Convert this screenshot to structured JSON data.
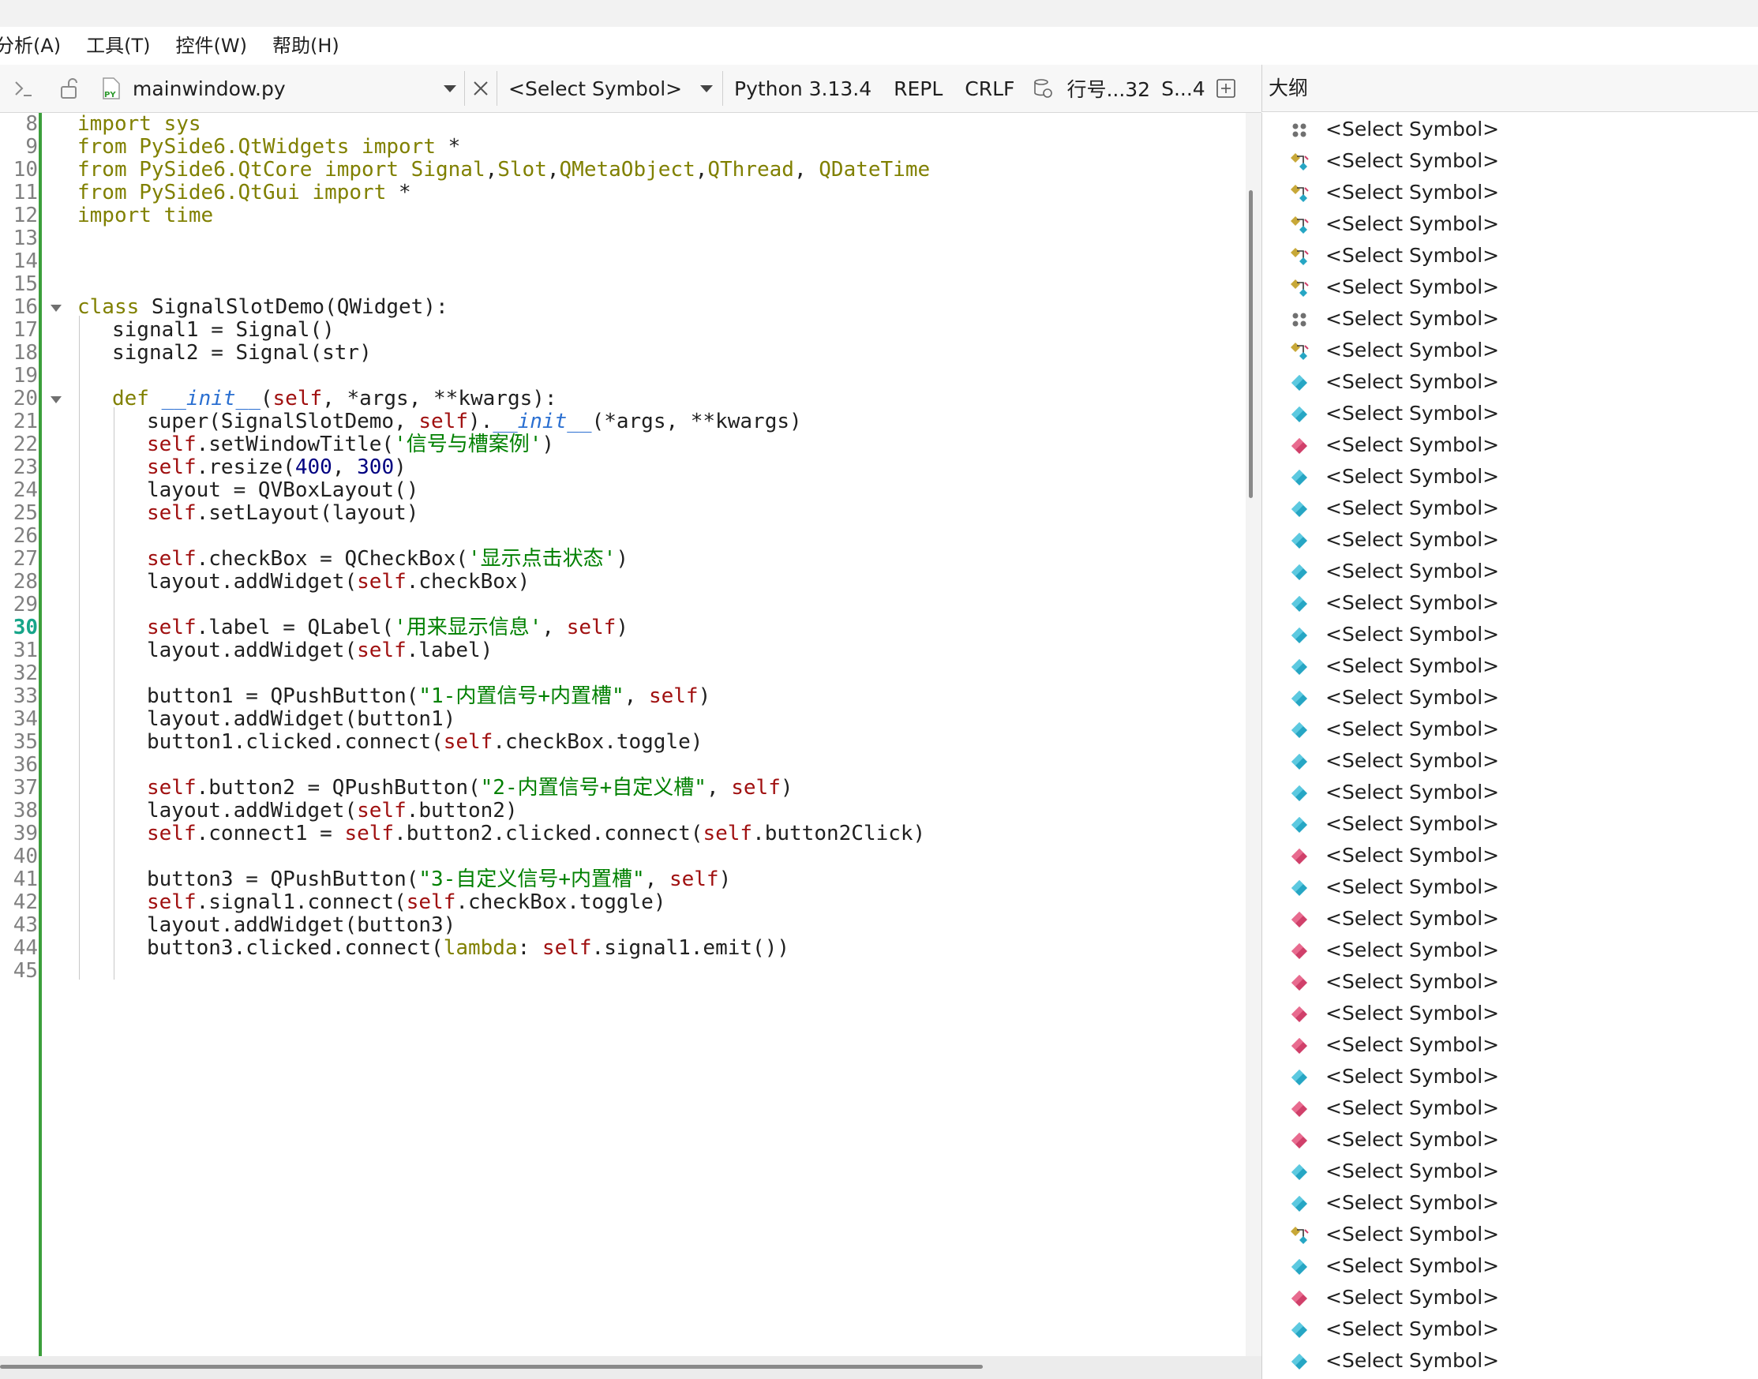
{
  "menu": [
    "分析(A)",
    "工具(T)",
    "控件(W)",
    "帮助(H)"
  ],
  "toolbar": {
    "file_name": "mainwindow.py",
    "symbol_combo": "<Select Symbol>",
    "python_version": "Python 3.13.4",
    "repl": "REPL",
    "line_ending": "CRLF",
    "position": "行号...32",
    "spaces": "S...4"
  },
  "outline_title": "大纲",
  "current_line": 30,
  "code_lines": [
    {
      "n": 8,
      "indent": 0,
      "fold": false,
      "html": "<span class=\"kw\">import</span> <span class=\"mod\">sys</span>"
    },
    {
      "n": 9,
      "indent": 0,
      "fold": false,
      "html": "<span class=\"kw\">from</span> <span class=\"mod\">PySide6.QtWidgets</span> <span class=\"kw\">import</span> *"
    },
    {
      "n": 10,
      "indent": 0,
      "fold": false,
      "html": "<span class=\"kw\">from</span> <span class=\"mod\">PySide6.QtCore</span> <span class=\"kw\">import</span> <span class=\"mod\">Signal</span>,<span class=\"mod\">Slot</span>,<span class=\"mod\">QMetaObject</span>,<span class=\"mod\">QThread</span>, <span class=\"mod\">QDateTime</span>"
    },
    {
      "n": 11,
      "indent": 0,
      "fold": false,
      "html": "<span class=\"kw\">from</span> <span class=\"mod\">PySide6.QtGui</span> <span class=\"kw\">import</span> *"
    },
    {
      "n": 12,
      "indent": 0,
      "fold": false,
      "html": "<span class=\"kw\">import</span> <span class=\"mod\">time</span>"
    },
    {
      "n": 13,
      "indent": 0,
      "fold": false,
      "html": ""
    },
    {
      "n": 14,
      "indent": 0,
      "fold": false,
      "html": ""
    },
    {
      "n": 15,
      "indent": 0,
      "fold": false,
      "html": ""
    },
    {
      "n": 16,
      "indent": 0,
      "fold": true,
      "html": "<span class=\"kw\">class</span> SignalSlotDemo(QWidget):"
    },
    {
      "n": 17,
      "indent": 1,
      "fold": false,
      "html": "signal1 = Signal()"
    },
    {
      "n": 18,
      "indent": 1,
      "fold": false,
      "html": "signal2 = Signal(str)"
    },
    {
      "n": 19,
      "indent": 1,
      "fold": false,
      "html": ""
    },
    {
      "n": 20,
      "indent": 1,
      "fold": true,
      "html": "<span class=\"kw\">def</span> <span class=\"dunder\">__init__</span>(<span class=\"self\">self</span>, *args, **kwargs):"
    },
    {
      "n": 21,
      "indent": 2,
      "fold": false,
      "html": "super(SignalSlotDemo, <span class=\"self\">self</span>).<span class=\"dunder\">__init__</span>(*args, **kwargs)"
    },
    {
      "n": 22,
      "indent": 2,
      "fold": false,
      "html": "<span class=\"self\">self</span>.setWindowTitle(<span class=\"str\">'信号与槽案例'</span>)"
    },
    {
      "n": 23,
      "indent": 2,
      "fold": false,
      "html": "<span class=\"self\">self</span>.resize(<span class=\"num\">400</span>, <span class=\"num\">300</span>)"
    },
    {
      "n": 24,
      "indent": 2,
      "fold": false,
      "html": "layout = QVBoxLayout()"
    },
    {
      "n": 25,
      "indent": 2,
      "fold": false,
      "html": "<span class=\"self\">self</span>.setLayout(layout)"
    },
    {
      "n": 26,
      "indent": 2,
      "fold": false,
      "html": ""
    },
    {
      "n": 27,
      "indent": 2,
      "fold": false,
      "html": "<span class=\"self\">self</span>.checkBox = QCheckBox(<span class=\"str\">'显示点击状态'</span>)"
    },
    {
      "n": 28,
      "indent": 2,
      "fold": false,
      "html": "layout.addWidget(<span class=\"self\">self</span>.checkBox)"
    },
    {
      "n": 29,
      "indent": 2,
      "fold": false,
      "html": ""
    },
    {
      "n": 30,
      "indent": 2,
      "fold": false,
      "html": "<span class=\"self\">self</span>.label = QLabel(<span class=\"str\">'用来显示信息'</span>, <span class=\"self\">self</span>)"
    },
    {
      "n": 31,
      "indent": 2,
      "fold": false,
      "html": "layout.addWidget(<span class=\"self\">self</span>.label)"
    },
    {
      "n": 32,
      "indent": 2,
      "fold": false,
      "html": ""
    },
    {
      "n": 33,
      "indent": 2,
      "fold": false,
      "html": "button1 = QPushButton(<span class=\"str\">\"1-内置信号+内置槽\"</span>, <span class=\"self\">self</span>)"
    },
    {
      "n": 34,
      "indent": 2,
      "fold": false,
      "html": "layout.addWidget(button1)"
    },
    {
      "n": 35,
      "indent": 2,
      "fold": false,
      "html": "button1.clicked.connect(<span class=\"self\">self</span>.checkBox.toggle)"
    },
    {
      "n": 36,
      "indent": 2,
      "fold": false,
      "html": ""
    },
    {
      "n": 37,
      "indent": 2,
      "fold": false,
      "html": "<span class=\"self\">self</span>.button2 = QPushButton(<span class=\"str\">\"2-内置信号+自定义槽\"</span>, <span class=\"self\">self</span>)"
    },
    {
      "n": 38,
      "indent": 2,
      "fold": false,
      "html": "layout.addWidget(<span class=\"self\">self</span>.button2)"
    },
    {
      "n": 39,
      "indent": 2,
      "fold": false,
      "html": "<span class=\"self\">self</span>.connect1 = <span class=\"self\">self</span>.button2.clicked.connect(<span class=\"self\">self</span>.button2Click)"
    },
    {
      "n": 40,
      "indent": 2,
      "fold": false,
      "html": ""
    },
    {
      "n": 41,
      "indent": 2,
      "fold": false,
      "html": "button3 = QPushButton(<span class=\"str\">\"3-自定义信号+内置槽\"</span>, <span class=\"self\">self</span>)"
    },
    {
      "n": 42,
      "indent": 2,
      "fold": false,
      "html": "<span class=\"self\">self</span>.signal1.connect(<span class=\"self\">self</span>.checkBox.toggle)"
    },
    {
      "n": 43,
      "indent": 2,
      "fold": false,
      "html": "layout.addWidget(button3)"
    },
    {
      "n": 44,
      "indent": 2,
      "fold": false,
      "html": "button3.clicked.connect(<span class=\"lam\">lambda</span>: <span class=\"self\">self</span>.signal1.emit())"
    },
    {
      "n": 45,
      "indent": 2,
      "fold": false,
      "html": ""
    }
  ],
  "outline_items": [
    {
      "label": "<Select Symbol>",
      "icon": "module-icon"
    },
    {
      "label": "<Select Symbol>",
      "icon": "import-icon"
    },
    {
      "label": "<Select Symbol>",
      "icon": "import-icon"
    },
    {
      "label": "<Select Symbol>",
      "icon": "import-icon"
    },
    {
      "label": "<Select Symbol>",
      "icon": "import-icon"
    },
    {
      "label": "<Select Symbol>",
      "icon": "import-icon"
    },
    {
      "label": "<Select Symbol>",
      "icon": "module-icon"
    },
    {
      "label": "<Select Symbol>",
      "icon": "class-icon"
    },
    {
      "label": "<Select Symbol>",
      "icon": "variable-icon"
    },
    {
      "label": "<Select Symbol>",
      "icon": "variable-icon"
    },
    {
      "label": "<Select Symbol>",
      "icon": "method-icon"
    },
    {
      "label": "<Select Symbol>",
      "icon": "variable-icon"
    },
    {
      "label": "<Select Symbol>",
      "icon": "variable-icon"
    },
    {
      "label": "<Select Symbol>",
      "icon": "variable-icon"
    },
    {
      "label": "<Select Symbol>",
      "icon": "variable-icon"
    },
    {
      "label": "<Select Symbol>",
      "icon": "variable-icon"
    },
    {
      "label": "<Select Symbol>",
      "icon": "variable-icon"
    },
    {
      "label": "<Select Symbol>",
      "icon": "variable-icon"
    },
    {
      "label": "<Select Symbol>",
      "icon": "variable-icon"
    },
    {
      "label": "<Select Symbol>",
      "icon": "variable-icon"
    },
    {
      "label": "<Select Symbol>",
      "icon": "variable-icon"
    },
    {
      "label": "<Select Symbol>",
      "icon": "variable-icon"
    },
    {
      "label": "<Select Symbol>",
      "icon": "variable-icon"
    },
    {
      "label": "<Select Symbol>",
      "icon": "method-icon"
    },
    {
      "label": "<Select Symbol>",
      "icon": "variable-icon"
    },
    {
      "label": "<Select Symbol>",
      "icon": "method-icon"
    },
    {
      "label": "<Select Symbol>",
      "icon": "method-icon"
    },
    {
      "label": "<Select Symbol>",
      "icon": "method-icon"
    },
    {
      "label": "<Select Symbol>",
      "icon": "method-icon"
    },
    {
      "label": "<Select Symbol>",
      "icon": "method-icon"
    },
    {
      "label": "<Select Symbol>",
      "icon": "variable-icon"
    },
    {
      "label": "<Select Symbol>",
      "icon": "method-icon"
    },
    {
      "label": "<Select Symbol>",
      "icon": "method-icon"
    },
    {
      "label": "<Select Symbol>",
      "icon": "variable-icon"
    },
    {
      "label": "<Select Symbol>",
      "icon": "variable-icon"
    },
    {
      "label": "<Select Symbol>",
      "icon": "class-icon"
    },
    {
      "label": "<Select Symbol>",
      "icon": "variable-icon"
    },
    {
      "label": "<Select Symbol>",
      "icon": "method-icon"
    },
    {
      "label": "<Select Symbol>",
      "icon": "variable-icon"
    },
    {
      "label": "<Select Symbol>",
      "icon": "variable-icon"
    }
  ],
  "colors": {
    "keyword": "#808000",
    "self": "#a01010",
    "string": "#008000",
    "number": "#000080",
    "dunder": "#2a6fd1",
    "current_line_number": "#17a589",
    "change_bar": "#3c9f3c",
    "variable_icon": "#26a6c4",
    "method_icon": "#d0406a",
    "import_icon": "#c8a838"
  }
}
